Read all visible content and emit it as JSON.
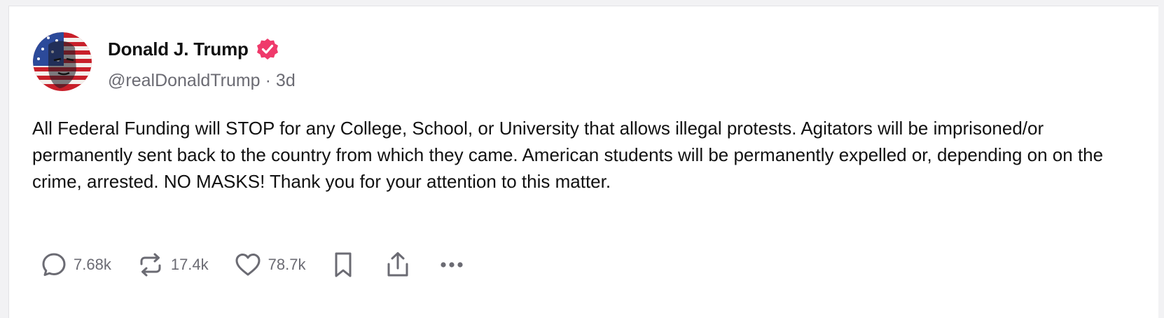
{
  "author": {
    "display_name": "Donald J. Trump",
    "handle": "@realDonaldTrump",
    "separator": "·",
    "time_ago": "3d",
    "verified_color": "#ef3a6b"
  },
  "post": {
    "text": "All Federal Funding will STOP for any College, School, or University that allows illegal protests. Agitators will be imprisoned/or permanently sent back to the country from which they came. American students will be permanently expelled or, depending on on the crime, arrested. NO MASKS! Thank you for your attention to this matter."
  },
  "actions": {
    "replies": "7.68k",
    "reposts": "17.4k",
    "likes": "78.7k",
    "icons": [
      "comment-icon",
      "repost-icon",
      "heart-icon",
      "bookmark-icon",
      "share-icon",
      "more-icon"
    ]
  },
  "colors": {
    "text": "#111111",
    "muted": "#6b6b73",
    "card_bg": "#ffffff",
    "page_bg": "#f2f2f4"
  }
}
